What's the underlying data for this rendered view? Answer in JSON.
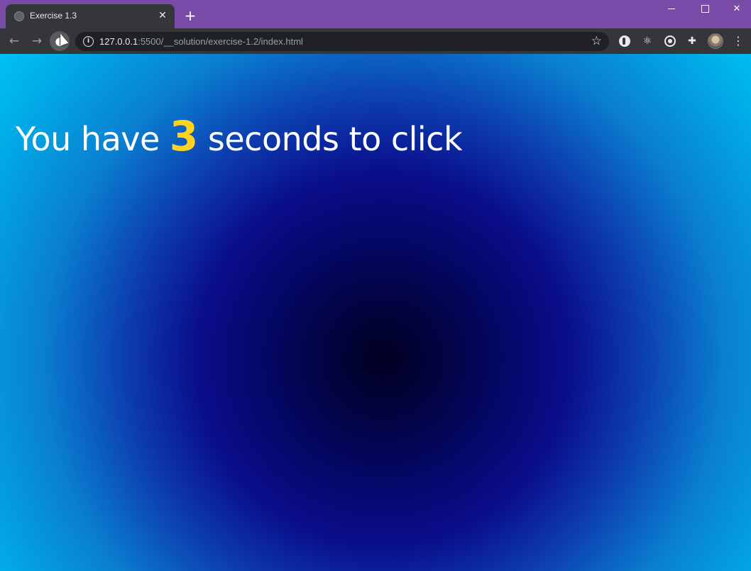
{
  "browser": {
    "tab_title": "Exercise 1.3",
    "tab_close_glyph": "✕",
    "new_tab_glyph": "+",
    "url_host": "127.0.0.1",
    "url_rest": ":5500/__solution/exercise-1.2/index.html",
    "star_glyph": "☆",
    "back_glyph": "←",
    "forward_glyph": "→",
    "reload_glyph": "◐",
    "close_glyph": "✕",
    "info_glyph": "i",
    "extensions": [
      "react-devtools-icon",
      "target-icon",
      "puzzle-icon"
    ],
    "menu_glyph": "⋮",
    "colors": {
      "titlebar": "#7a4aa8",
      "toolbar": "#35363a",
      "omnibox": "#202124"
    }
  },
  "page": {
    "headline_before": "You have ",
    "seconds": "3",
    "headline_after": " seconds to click",
    "colors": {
      "count": "#ffd21f",
      "text": "#ffffff",
      "gradient_center": "#000020",
      "gradient_edge": "#00d4fb"
    }
  }
}
